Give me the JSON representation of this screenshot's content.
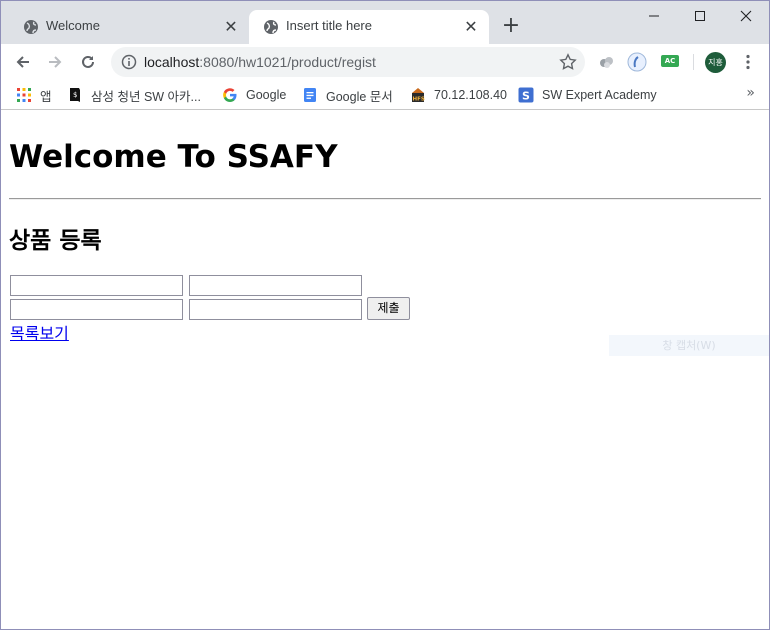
{
  "browser": {
    "tabs": [
      {
        "title": "Welcome",
        "active": false
      },
      {
        "title": "Insert title here",
        "active": true
      }
    ],
    "new_tab_label": "+",
    "address": {
      "host": "localhost",
      "path": ":8080/hw1021/product/regist"
    },
    "profile_initials": "지홍",
    "extension_badge": "AC",
    "bookmarks": [
      {
        "label": "앱",
        "icon": "apps-grid-icon"
      },
      {
        "label": "삼성 청년 SW 아카...",
        "icon": "ssafy-icon"
      },
      {
        "label": "Google",
        "icon": "google-icon"
      },
      {
        "label": "Google 문서",
        "icon": "google-docs-icon"
      },
      {
        "label": "70.12.108.40",
        "icon": "hfs-icon"
      },
      {
        "label": "SW Expert Academy",
        "icon": "swea-icon"
      }
    ],
    "bookmarks_more": "»"
  },
  "page": {
    "heading": "Welcome To SSAFY",
    "subheading": "상품 등록",
    "form": {
      "fields": [
        {
          "value": "",
          "placeholder": ""
        },
        {
          "value": "",
          "placeholder": ""
        },
        {
          "value": "",
          "placeholder": ""
        },
        {
          "value": "",
          "placeholder": ""
        }
      ],
      "submit_label": "제출"
    },
    "list_link": "목록보기",
    "overlay_hint": "창 캡처(W)"
  },
  "colors": {
    "tabstrip": "#dee1e6",
    "link": "#0000ee",
    "profile": "#1e5c3a"
  }
}
